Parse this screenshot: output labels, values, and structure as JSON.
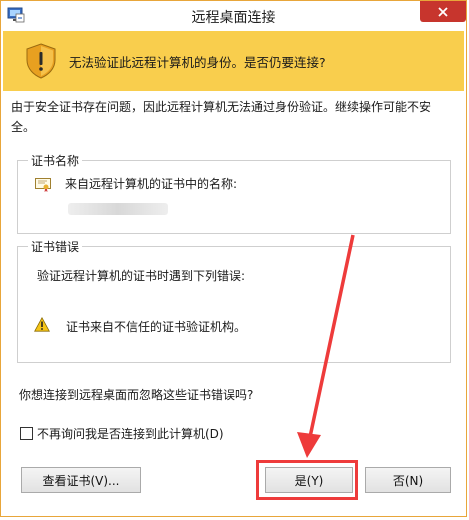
{
  "window": {
    "title": "远程桌面连接"
  },
  "banner": {
    "text": "无法验证此远程计算机的身份。是否仍要连接?"
  },
  "description": "由于安全证书存在问题，因此远程计算机无法通过身份验证。继续操作可能不安全。",
  "cert_name_group": {
    "label": "证书名称",
    "text": "来自远程计算机的证书中的名称:"
  },
  "cert_error_group": {
    "label": "证书错误",
    "intro": "验证远程计算机的证书时遇到下列错误:",
    "error": "证书来自不信任的证书验证机构。"
  },
  "question": "你想连接到远程桌面而忽略这些证书错误吗?",
  "checkbox": {
    "label": "不再询问我是否连接到此计算机(D)",
    "checked": false
  },
  "buttons": {
    "view": "查看证书(V)...",
    "yes": "是(Y)",
    "no": "否(N)"
  },
  "colors": {
    "banner": "#f9ce4d",
    "close": "#c7352d",
    "annotation": "#ee3b3b"
  }
}
